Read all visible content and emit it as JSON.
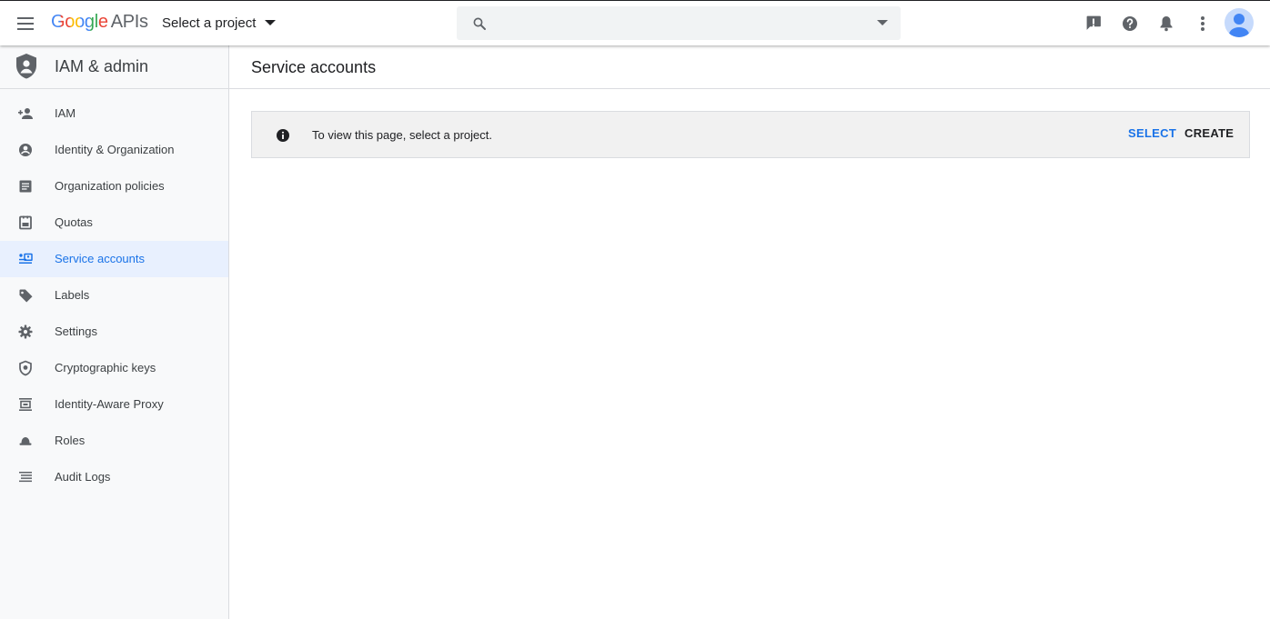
{
  "header": {
    "logo_google": "Google",
    "logo_apis": "APIs",
    "project_picker": "Select a project",
    "search_placeholder": ""
  },
  "sidebar": {
    "title": "IAM & admin",
    "items": [
      {
        "label": "IAM",
        "icon": "person-add-icon"
      },
      {
        "label": "Identity & Organization",
        "icon": "account-circle-icon"
      },
      {
        "label": "Organization policies",
        "icon": "document-list-icon"
      },
      {
        "label": "Quotas",
        "icon": "quota-icon"
      },
      {
        "label": "Service accounts",
        "icon": "service-account-icon",
        "active": true
      },
      {
        "label": "Labels",
        "icon": "label-tag-icon"
      },
      {
        "label": "Settings",
        "icon": "gear-icon"
      },
      {
        "label": "Cryptographic keys",
        "icon": "shield-key-icon"
      },
      {
        "label": "Identity-Aware Proxy",
        "icon": "proxy-icon"
      },
      {
        "label": "Roles",
        "icon": "roles-hat-icon"
      },
      {
        "label": "Audit Logs",
        "icon": "list-lines-icon"
      }
    ]
  },
  "main": {
    "page_title": "Service accounts",
    "notice": {
      "message": "To view this page, select a project.",
      "select_label": "SELECT",
      "create_label": "CREATE"
    }
  },
  "colors": {
    "accent": "#1a73e8",
    "active_bg": "#e8f0fe",
    "sidebar_bg": "#f8f9fa",
    "notice_bg": "#f1f1f1",
    "icon_grey": "#5f6368"
  }
}
